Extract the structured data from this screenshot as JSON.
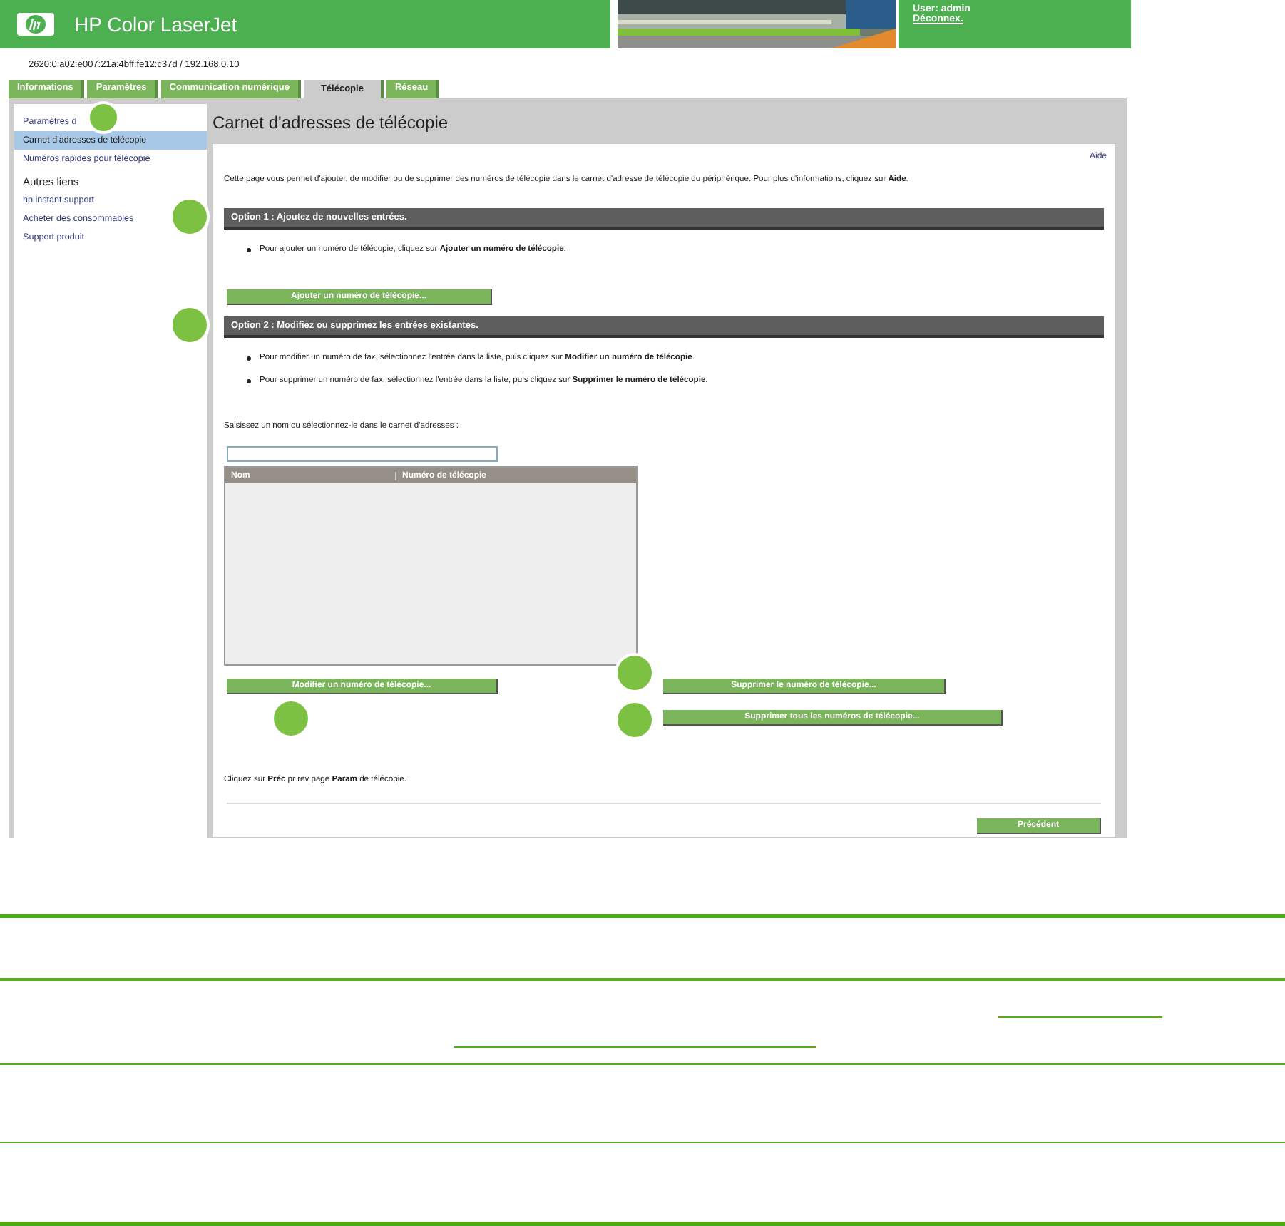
{
  "header": {
    "title": "HP Color LaserJet",
    "user": "User: admin",
    "logout": "Déconnex.",
    "address": "2620:0:a02:e007:21a:4bff:fe12:c37d / 192.168.0.10"
  },
  "tabs": [
    {
      "label": "Informations",
      "selected": false
    },
    {
      "label": "Paramètres",
      "selected": false
    },
    {
      "label": "Communication numérique",
      "selected": false
    },
    {
      "label": "Télécopie",
      "selected": true
    },
    {
      "label": "Réseau",
      "selected": false
    }
  ],
  "sidebar": {
    "items": [
      {
        "label": "Paramètres d",
        "selected": false
      },
      {
        "label": "Carnet d'adresses de télécopie",
        "selected": true
      },
      {
        "label": "Numéros rapides pour télécopie",
        "selected": false
      }
    ],
    "heading": "Autres liens",
    "links": [
      "hp instant support",
      "Acheter des consommables",
      "Support produit"
    ]
  },
  "page": {
    "title": "Carnet d'adresses de télécopie",
    "help": "Aide",
    "intro": "Cette page vous permet d'ajouter, de modifier ou de supprimer des numéros de télécopie dans le carnet d'adresse de télécopie du périphérique. Pour plus d'informations, cliquez sur **Aide**.",
    "option1": {
      "heading": "Option 1 : Ajoutez de nouvelles entrées.",
      "bullets": [
        "Pour ajouter un numéro de télécopie, cliquez sur **Ajouter un numéro de télécopie**."
      ],
      "button": "Ajouter un numéro de télécopie..."
    },
    "option2": {
      "heading": "Option 2 : Modifiez ou supprimez les entrées existantes.",
      "bullets": [
        "Pour modifier un numéro de fax, sélectionnez l'entrée dans la liste, puis cliquez sur **Modifier un numéro de télécopie**.",
        "Pour supprimer un numéro de fax, sélectionnez l'entrée dans la liste, puis cliquez sur **Supprimer le numéro de télécopie**."
      ]
    },
    "search_label": "Saisissez un nom ou sélectionnez-le dans le carnet d'adresses :",
    "table": {
      "columns": [
        "Nom",
        "Numéro de télécopie"
      ]
    },
    "modify_button": "Modifier un numéro de télécopie...",
    "delete_button": "Supprimer le numéro de télécopie...",
    "delete_all_button": "Supprimer tous les numéros de télécopie...",
    "back_note": "Cliquez sur **Préc** pr rev page **Param** de télécopie.",
    "back_button": "Précédent"
  }
}
